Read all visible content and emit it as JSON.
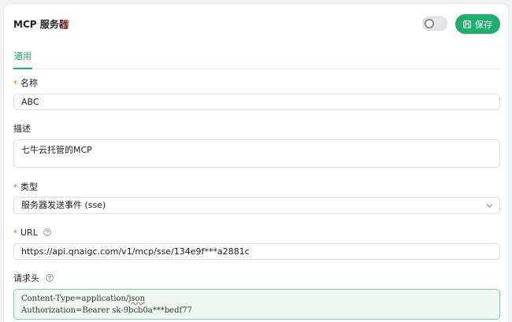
{
  "header": {
    "title": "MCP 服务器",
    "save_label": "保存",
    "toggle_state": "off",
    "accent_color": "#1fae6e",
    "danger_color": "#e2574c"
  },
  "tabs": [
    {
      "label": "通用",
      "active": true
    }
  ],
  "form": {
    "name": {
      "label": "名称",
      "required": true,
      "value": "ABC"
    },
    "description": {
      "label": "描述",
      "required": false,
      "value": "七牛云托管的MCP"
    },
    "type": {
      "label": "类型",
      "required": true,
      "selected": "服务器发送事件 (sse)"
    },
    "url": {
      "label": "URL",
      "required": true,
      "value": "https://api.qnaigc.com/v1/mcp/sse/134e9f***a2881c"
    },
    "headers": {
      "label": "请求头",
      "line1_prefix": "Content-Type=application/",
      "line1_suffix": "json",
      "line2": "Authorization=Bearer sk-9bcb0a***bedf77"
    }
  },
  "icons": {
    "trash": "trash-icon",
    "save": "save-icon",
    "help": "help-circle-icon",
    "chevron": "chevron-down-icon"
  }
}
